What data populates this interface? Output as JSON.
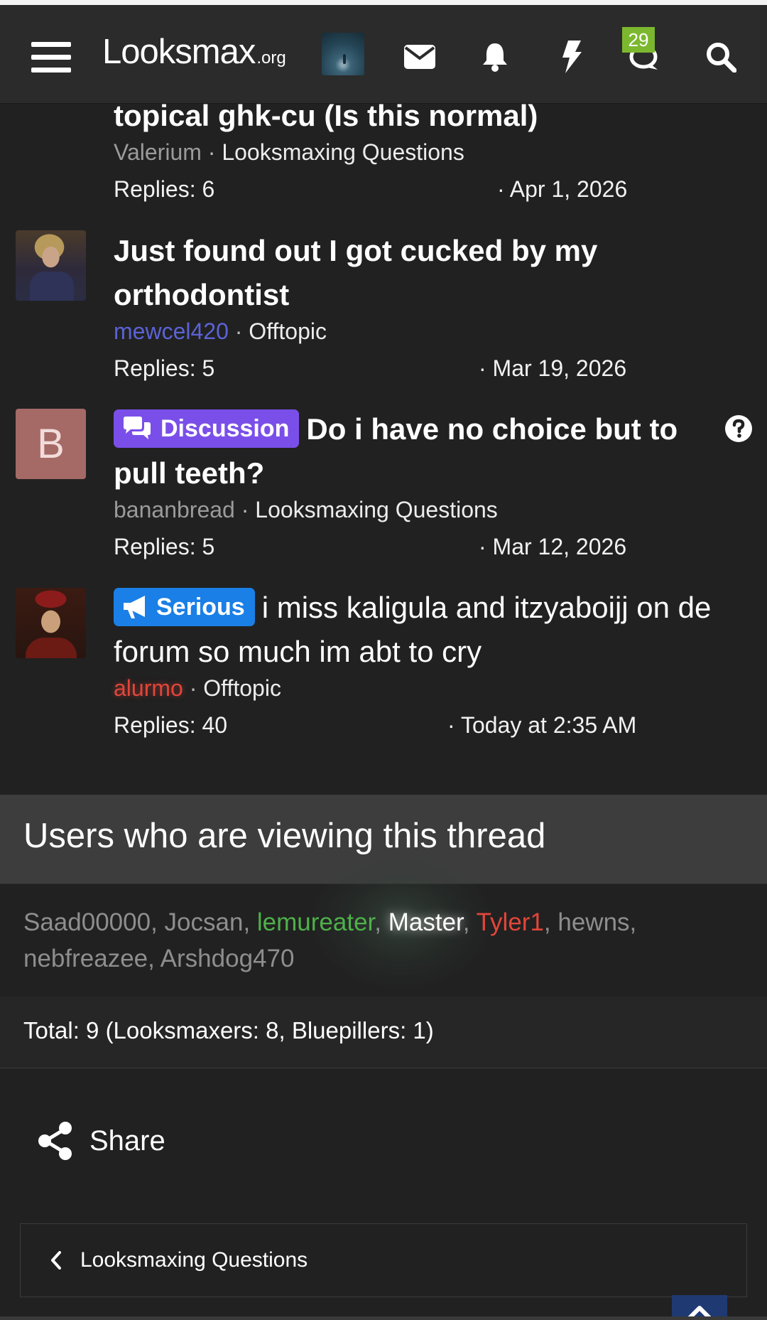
{
  "header": {
    "logo_main": "Lᴏoksmax",
    "logo_suffix": ".org",
    "chat_badge": "29"
  },
  "threads": [
    {
      "title": "topical ghk-cu (Is this normal)",
      "author": "Valerium",
      "forum": "Looksmaxing Questions",
      "replies": "Replies: 6",
      "date": "Apr 1, 2026"
    },
    {
      "title": "Just found out I got cucked by my orthodontist",
      "author": "mewcel420",
      "author_color": "#5b63d6",
      "forum": "Offtopic",
      "replies": "Replies: 5",
      "date": "Mar 19, 2026"
    },
    {
      "prefix": "Discussion",
      "title": "Do i have no choice but to pull teeth?",
      "avatar_letter": "B",
      "author": "bananbread",
      "forum": "Looksmaxing Questions",
      "replies": "Replies: 5",
      "date": "Mar 12, 2026"
    },
    {
      "prefix": "Serious",
      "title": "i miss kaligula and itzyaboijj on de forum so much im abt to cry",
      "author": "alurmo",
      "author_color": "#e2453a",
      "forum": "Offtopic",
      "replies": "Replies: 40",
      "date": "Today at 2:35 AM"
    }
  ],
  "viewers": {
    "title": "Users who are viewing this thread",
    "users": [
      "Saad00000",
      "Jocsan",
      "lemureater",
      "Master",
      "Tyler1",
      "hewns",
      "nebfreazee",
      "Arshdog470"
    ],
    "total": "Total: 9 (Looksmaxers: 8, Bluepillers: 1)"
  },
  "share_label": "Share",
  "breadcrumb_label": "Looksmaxing Questions",
  "colors": {
    "background": "#212121",
    "navbar": "#2b2b2b",
    "badge": "#7cb82f",
    "discussion_prefix": "#7a4fe9",
    "serious_prefix": "#1a7fe6",
    "user_green": "#4fb04a",
    "user_red": "#e2453a",
    "to_top_button": "#1f3a73"
  },
  "icons": [
    "menu-icon",
    "envelope-icon",
    "bell-icon",
    "bolt-icon",
    "chat-icon",
    "search-icon",
    "question-icon",
    "comments-icon",
    "megaphone-icon",
    "share-icon",
    "chevron-left-icon",
    "chevron-up-icon"
  ]
}
